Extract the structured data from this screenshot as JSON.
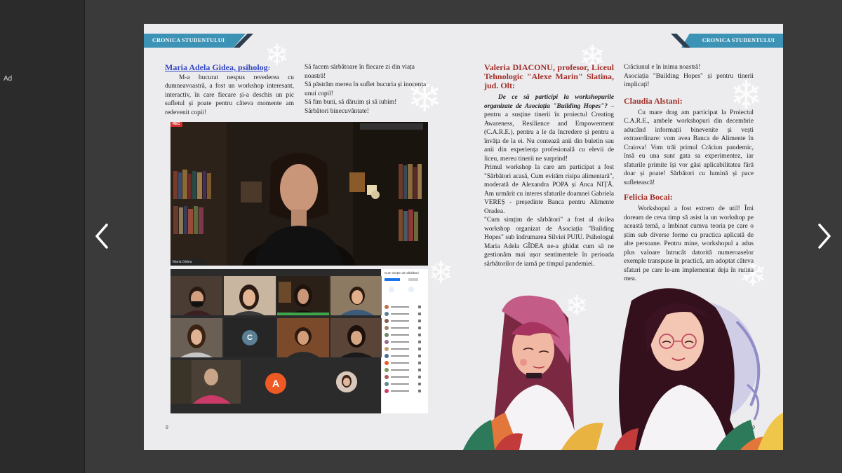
{
  "sidebar": {
    "ad_label": "Ad"
  },
  "nav": {
    "prev_icon": "chevron-left-icon",
    "next_icon": "chevron-right-icon"
  },
  "banner": {
    "left": "CRONICA STUDENTULUI",
    "right": "CRONICA STUDENTULUI"
  },
  "left_page": {
    "author": "Maria Adela Gidea, psiholog",
    "author_colon": ":",
    "col1_body": "M-a bucurat nespus revederea cu dumneavoastră, a fost un workshop interesant, interactiv, în care fiecare și-a deschis un pic sufletul și poate pentru câteva momente am redevenit copii!",
    "col2_lines": [
      "Să facem sărbătoare în fiecare zi din viața noastră!",
      "Să păstrăm mereu în suflet bucuria și inocența unui copil!",
      "Să fim buni, să dăruim și să iubim!",
      "Sărbători binecuvântate!"
    ],
    "page_number": "8"
  },
  "video_call": {
    "rec_label": "REC",
    "avatar_c": "C",
    "avatar_a": "A",
    "speaker_bar_label": "Maria Gidea",
    "panel_title": "Cum simțim de sărbători"
  },
  "right_page": {
    "author1": "Valeria DIACONU, profesor, Liceul Tehnologic \"Alexe Marin\" Slatina, jud. Olt:",
    "question": "De ce să participi la workshopurile organizate de Asociația \"Building Hopes\"?",
    "para1": " – pentru a susține tinerii în proiectul Creating Awareness, Resilience and Empowerment (C.A.R.E.), pentru a le da încredere și pentru a învăța de la ei. Nu contează anii din buletin sau anii din experiența profesională cu elevii de liceu, mereu tinerii ne surprind!",
    "para2": "Primul workshop la care am participat a fost \"Sărbători acasă, Cum evităm risipa alimentară\", moderată de Alexandra POPA și Anca NIȚĂ. Am urmărit cu interes sfaturile doamnei Gabriela VEREȘ - președinte Banca pentru Alimente Oradea.",
    "para3": "\"Cum simțim de sărbători\" a fost al doilea workshop organizat de Asociația \"Building Hopes\" sub îndrumarea Silviei PUIU. Psihologul Maria Adela GÎDEA ne-a ghidat cum să ne gestionăm mai ușor sentimentele în perioada sărbătorilor de iarnă pe timpul pandemiei.",
    "col2_top": "Crăciunul e în inima noastră!",
    "col2_top2": "Asociația \"Building Hopes\" și pentru tinerii implicați!",
    "author2": "Claudia Alstani:",
    "para4": "Cu mare drag am participat la Proiectul C.A.R.E., ambele workshopuri din decembrie aducând informații binevenite și vești extraordinare: vom avea Banca de Alimente în Craiova! Vom trăi primul Crăciun pandemic, însă eu una sunt gata sa experimentez, iar sfaturile primite își vor găsi aplicabilitatea fără doar și poate! Sărbători cu lumină și pace sufletească!",
    "author3": "Felicia Bocai:",
    "para5": "Workshopul a fost extrem de util! Îmi doream de ceva timp să asist la un workshop pe această temă, a îmbinat cumva teoria pe care o știm sub diverse forme cu practica aplicată de alte persoane. Pentru mine, workshopul a adus plus valoare întrucât datorită numeroaselor exemple transpuse în practică, am adoptat câteva sfaturi pe care le-am implementat deja în rutina mea.",
    "page_number": "9"
  },
  "colors": {
    "banner": "#3d93b6",
    "author_red": "#a2312a",
    "author_blue": "#3347c2",
    "paper": "#ecebee"
  }
}
